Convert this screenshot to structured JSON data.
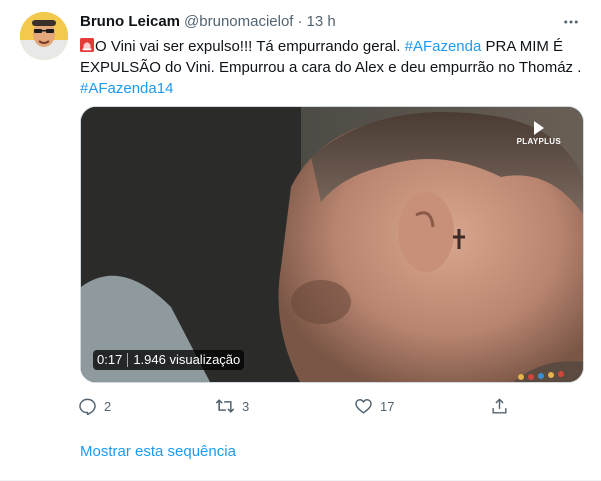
{
  "tweet": {
    "author_name": "Bruno Leicam",
    "handle": "@brunomacielof",
    "separator": "·",
    "time": "13 h",
    "text": {
      "line1_siren_icon": "rotating-light-emoji",
      "line1_a": "O Vini vai ser expulso!!! Tá empurrando geral. ",
      "line1_hashtag": "#AFazenda",
      "line1_b": " PRA MIM É",
      "line2": "EXPULSÃO do Vini. Empurrou a cara do Alex e deu empurrão no Thomáz .",
      "line3_hashtag": "#AFazenda14"
    },
    "media": {
      "watermark": "PLAYPLUS",
      "duration": "0:17",
      "views": "1.946 visualização"
    },
    "actions": {
      "reply_count": "2",
      "retweet_count": "3",
      "like_count": "17"
    },
    "show_thread": "Mostrar esta sequência"
  },
  "colors": {
    "accent": "#1d9bf0",
    "muted": "#536471",
    "text": "#0f1419"
  }
}
